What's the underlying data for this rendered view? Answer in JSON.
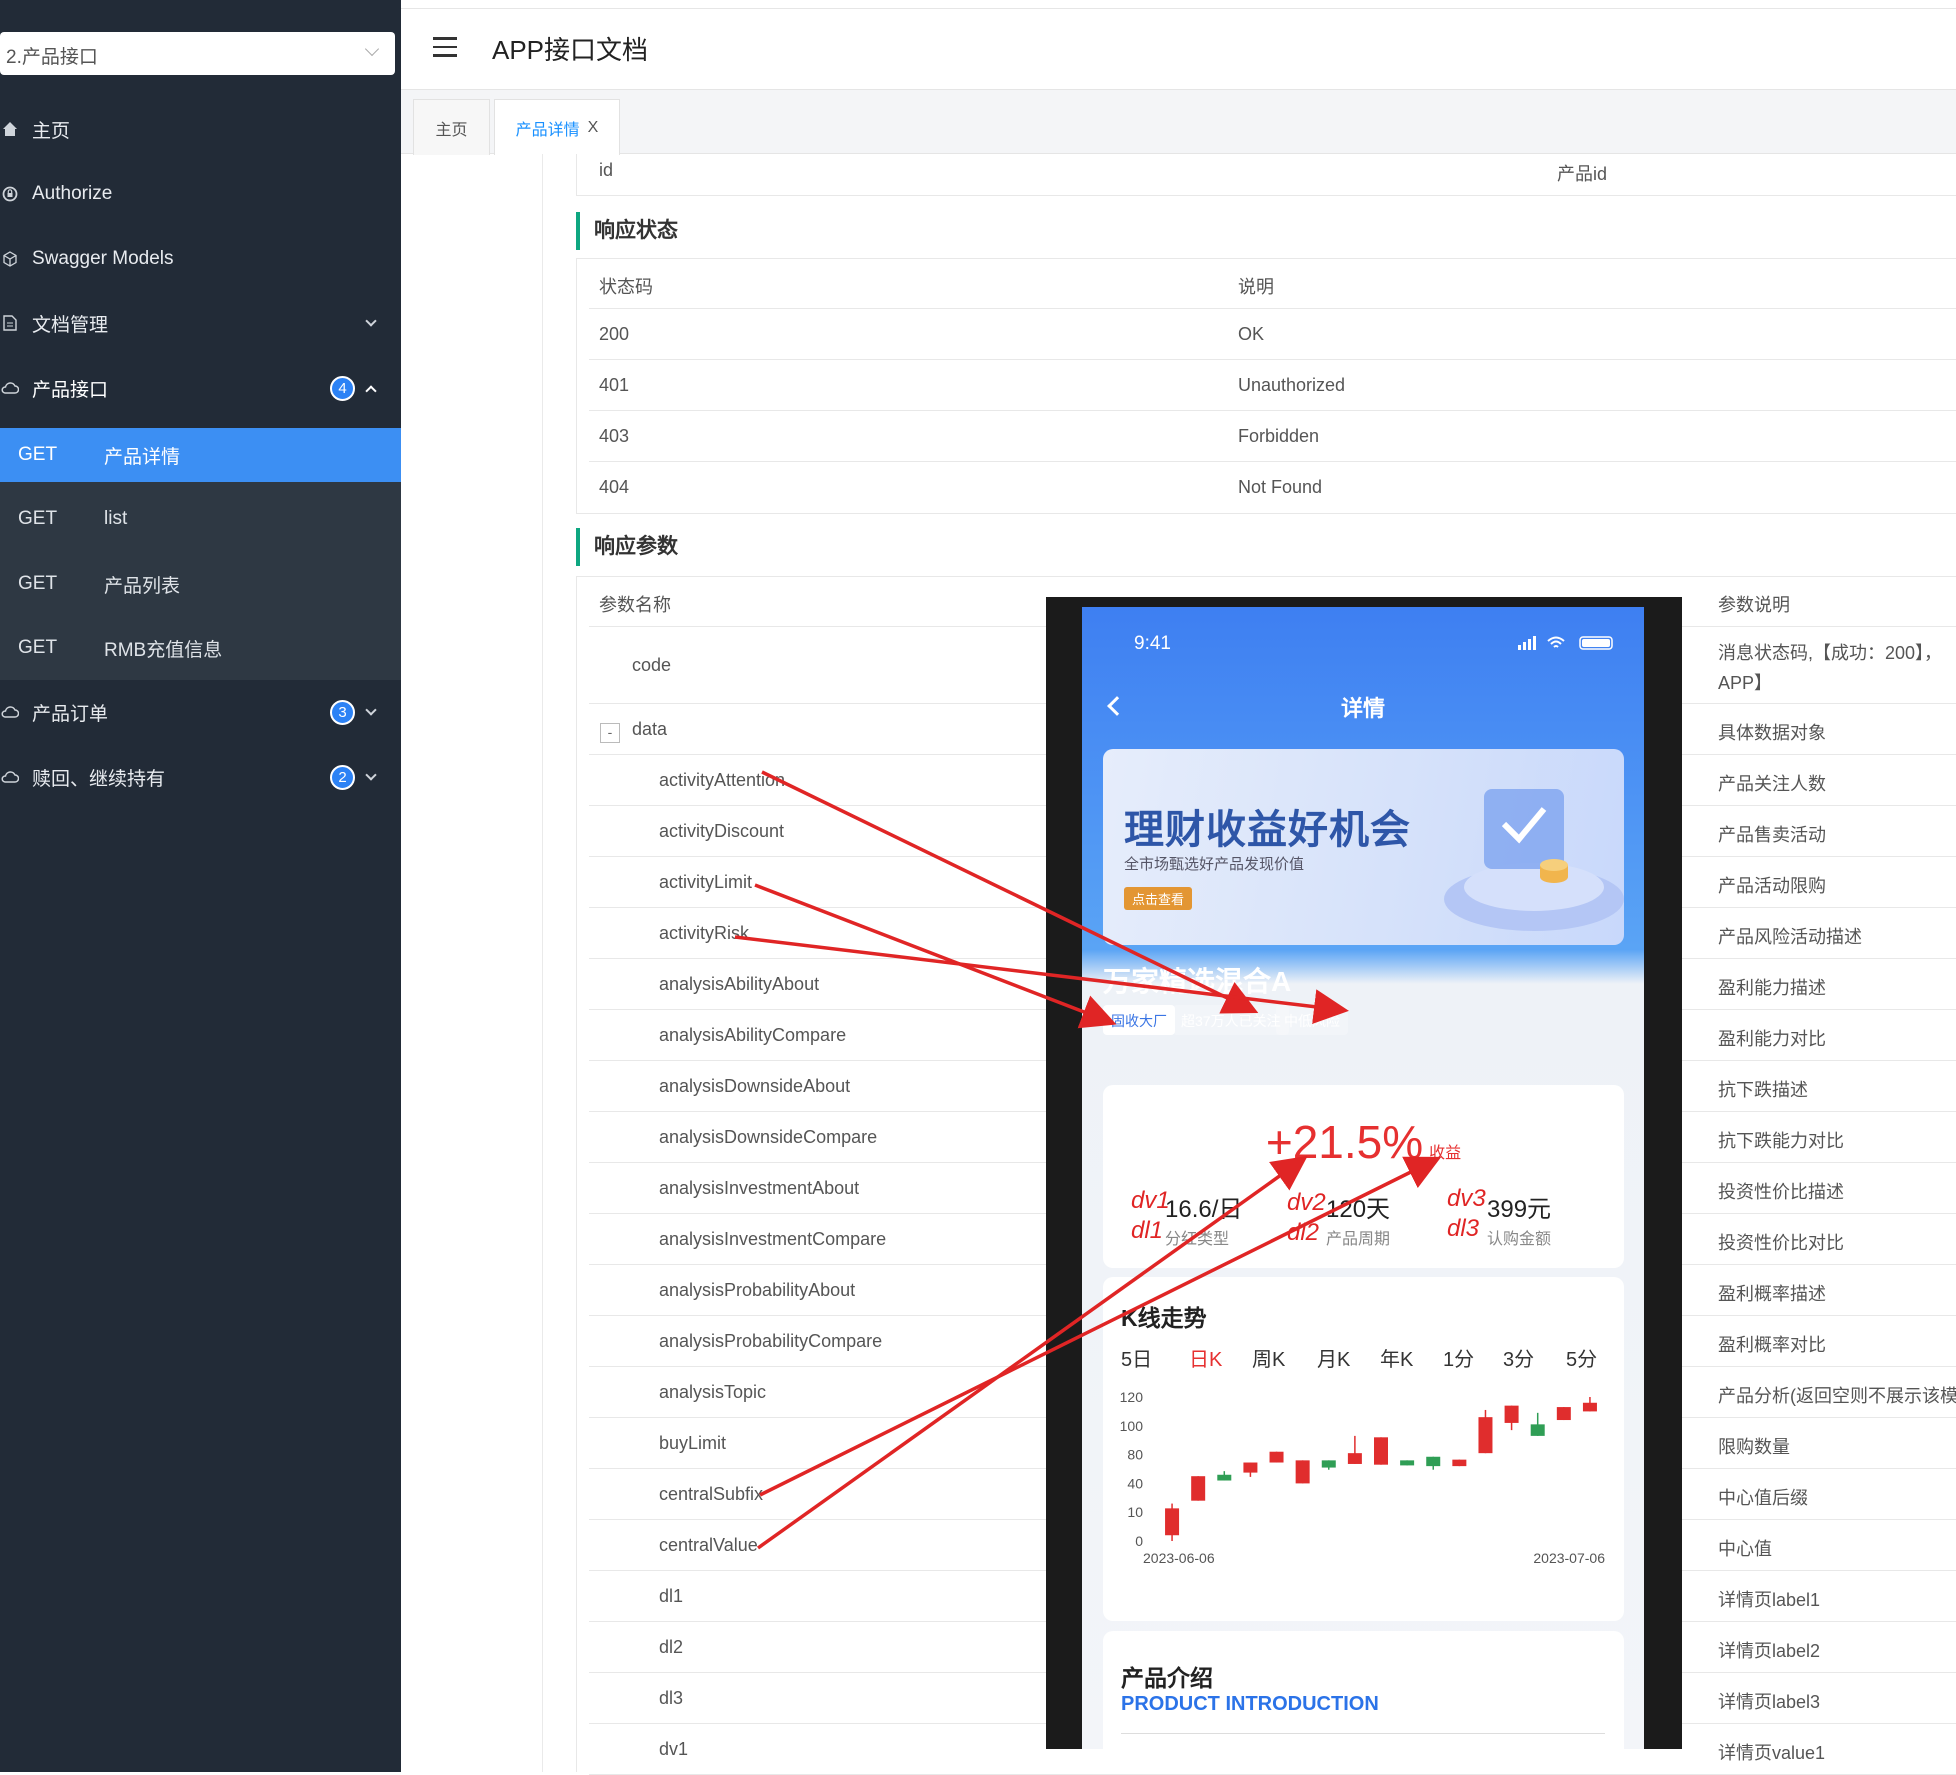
{
  "sidebar": {
    "select_value": "2.产品接口",
    "items": [
      {
        "label": "主页",
        "icon": "home-icon"
      },
      {
        "label": "Authorize",
        "icon": "lock-icon"
      },
      {
        "label": "Swagger Models",
        "icon": "cube-icon"
      },
      {
        "label": "文档管理",
        "icon": "document-icon"
      },
      {
        "label": "产品接口",
        "icon": "cloud-icon",
        "badge": "4"
      },
      {
        "label": "产品订单",
        "icon": "cloud-icon",
        "badge": "3"
      },
      {
        "label": "赎回、继续持有",
        "icon": "cloud-icon",
        "badge": "2"
      }
    ],
    "sub_items": [
      {
        "method": "GET",
        "title": "产品详情"
      },
      {
        "method": "GET",
        "title": "list"
      },
      {
        "method": "GET",
        "title": "产品列表"
      },
      {
        "method": "GET",
        "title": "RMB充值信息"
      }
    ]
  },
  "header": {
    "title": "APP接口文档"
  },
  "tabs": {
    "home": "主页",
    "detail": "产品详情",
    "close": "X"
  },
  "request_row": {
    "name": "id",
    "desc": "产品id"
  },
  "response_status": {
    "title": "响应状态",
    "headers": [
      "状态码",
      "说明"
    ],
    "rows": [
      [
        "200",
        "OK"
      ],
      [
        "401",
        "Unauthorized"
      ],
      [
        "403",
        "Forbidden"
      ],
      [
        "404",
        "Not Found"
      ]
    ]
  },
  "response_params": {
    "title": "响应参数",
    "headers": [
      "参数名称",
      "参数说明"
    ],
    "collapse": "-",
    "rows": [
      {
        "name": "code",
        "desc": "消息状态码,【成功：200】，",
        "desc2": "APP】"
      },
      {
        "name": "data",
        "desc": "具体数据对象"
      },
      {
        "name": "activityAttention",
        "desc": "产品关注人数"
      },
      {
        "name": "activityDiscount",
        "desc": "产品售卖活动"
      },
      {
        "name": "activityLimit",
        "desc": "产品活动限购"
      },
      {
        "name": "activityRisk",
        "desc": "产品风险活动描述"
      },
      {
        "name": "analysisAbilityAbout",
        "desc": "盈利能力描述"
      },
      {
        "name": "analysisAbilityCompare",
        "desc": "盈利能力对比"
      },
      {
        "name": "analysisDownsideAbout",
        "desc": "抗下跌描述"
      },
      {
        "name": "analysisDownsideCompare",
        "desc": "抗下跌能力对比"
      },
      {
        "name": "analysisInvestmentAbout",
        "desc": "投资性价比描述"
      },
      {
        "name": "analysisInvestmentCompare",
        "desc": "投资性价比对比"
      },
      {
        "name": "analysisProbabilityAbout",
        "desc": "盈利概率描述"
      },
      {
        "name": "analysisProbabilityCompare",
        "desc": "盈利概率对比"
      },
      {
        "name": "analysisTopic",
        "desc": "产品分析(返回空则不展示该模"
      },
      {
        "name": "buyLimit",
        "desc": "限购数量"
      },
      {
        "name": "centralSubfix",
        "desc": "中心值后缀"
      },
      {
        "name": "centralValue",
        "desc": "中心值"
      },
      {
        "name": "dl1",
        "desc": "详情页label1"
      },
      {
        "name": "dl2",
        "desc": "详情页label2"
      },
      {
        "name": "dl3",
        "desc": "详情页label3"
      },
      {
        "name": "dv1",
        "desc": "详情页value1"
      }
    ]
  },
  "phone": {
    "time": "9:41",
    "nav_title": "详情",
    "banner": {
      "title": "理财收益好机会",
      "subtitle": "全市场甄选好产品发现价值",
      "button": "点击查看"
    },
    "product_name": "万家精选混合A",
    "tags": [
      "固收大厂",
      "超37万人已关注",
      "中低风险"
    ],
    "yield_value": "+21.5%",
    "yield_label": "收益",
    "values": [
      {
        "value": "16.6/日",
        "label": "分红类型",
        "vtag": "dv1",
        "ltag": "dl1"
      },
      {
        "value": "120天",
        "label": "产品周期",
        "vtag": "dv2",
        "ltag": "dl2"
      },
      {
        "value": "399元",
        "label": "认购金额",
        "vtag": "dv3",
        "ltag": "dl3"
      }
    ],
    "kline": {
      "title": "K线走势",
      "tabs": [
        "5日",
        "日K",
        "周K",
        "月K",
        "年K",
        "1分",
        "3分",
        "5分"
      ],
      "active_tab": "日K"
    },
    "intro": {
      "title": "产品介绍",
      "subtitle": "PRODUCT INTRODUCTION"
    }
  },
  "chart_data": {
    "type": "candlestick",
    "y_ticks": [
      "0",
      "10",
      "40",
      "80",
      "100",
      "120"
    ],
    "x_labels": [
      "2023-06-06",
      "2023-07-06"
    ],
    "colors": {
      "up": "#e02d2d",
      "down": "#2f9e55"
    },
    "candles": [
      {
        "open": 2,
        "close": 14,
        "high": 19,
        "low": 0,
        "dir": "up"
      },
      {
        "open": 22,
        "close": 50,
        "high": 50,
        "low": 22,
        "dir": "up"
      },
      {
        "open": 52,
        "close": 44,
        "high": 57,
        "low": 44,
        "dir": "down"
      },
      {
        "open": 55,
        "close": 69,
        "high": 69,
        "low": 49,
        "dir": "up"
      },
      {
        "open": 69,
        "close": 82,
        "high": 82,
        "low": 69,
        "dir": "up"
      },
      {
        "open": 40,
        "close": 72,
        "high": 72,
        "low": 40,
        "dir": "up"
      },
      {
        "open": 72,
        "close": 62,
        "high": 72,
        "low": 59,
        "dir": "down"
      },
      {
        "open": 67,
        "close": 81,
        "high": 93,
        "low": 67,
        "dir": "up"
      },
      {
        "open": 66,
        "close": 92,
        "high": 92,
        "low": 66,
        "dir": "up"
      },
      {
        "open": 72,
        "close": 65,
        "high": 72,
        "low": 65,
        "dir": "down"
      },
      {
        "open": 77,
        "close": 64,
        "high": 77,
        "low": 59,
        "dir": "down"
      },
      {
        "open": 64,
        "close": 73,
        "high": 73,
        "low": 64,
        "dir": "up"
      },
      {
        "open": 81,
        "close": 106,
        "high": 111,
        "low": 81,
        "dir": "up"
      },
      {
        "open": 102,
        "close": 114,
        "high": 114,
        "low": 97,
        "dir": "up"
      },
      {
        "open": 101,
        "close": 93,
        "high": 109,
        "low": 93,
        "dir": "down"
      },
      {
        "open": 104,
        "close": 113,
        "high": 113,
        "low": 104,
        "dir": "up"
      },
      {
        "open": 110,
        "close": 116,
        "high": 120,
        "low": 110,
        "dir": "up"
      }
    ]
  }
}
